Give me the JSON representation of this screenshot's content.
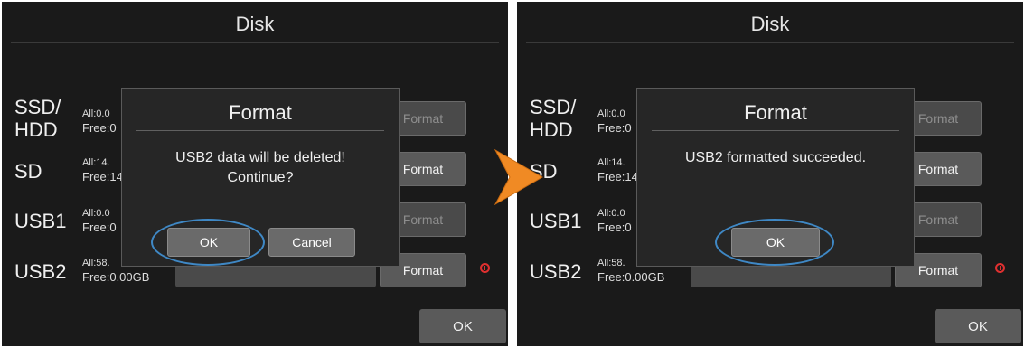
{
  "title": "Disk",
  "disks": [
    {
      "label": "SSD/\nHDD",
      "all": "All:0.0",
      "free": "Free:0",
      "format": "Format",
      "enabled": false
    },
    {
      "label": "SD",
      "all": "All:14.",
      "free": "Free:14",
      "format": "Format",
      "enabled": true
    },
    {
      "label": "USB1",
      "all": "All:0.0",
      "free": "Free:0",
      "format": "Format",
      "enabled": false
    },
    {
      "label": "USB2",
      "all": "All:58.",
      "free": "Free:0.00GB",
      "format": "Format",
      "enabled": true
    }
  ],
  "ok_label": "OK",
  "left_dialog": {
    "title": "Format",
    "message_line1": "USB2 data will be deleted!",
    "message_line2": "Continue?",
    "ok_label": "OK",
    "cancel_label": "Cancel"
  },
  "right_dialog": {
    "title": "Format",
    "message": "USB2 formatted succeeded.",
    "ok_label": "OK"
  },
  "right_disks": [
    {
      "label": "SSD/\nHDD",
      "all": "All:0.0",
      "free": "Free:0",
      "format": "Format"
    },
    {
      "label": "SD",
      "all": "All:14.",
      "free": "Free:14",
      "format": "Format"
    },
    {
      "label": "USB1",
      "all": "All:0.0",
      "free": "Free:0",
      "format": "Format"
    },
    {
      "label": "USB2",
      "all": "All:58.",
      "free": "Free:0.00GB",
      "format": "Format"
    }
  ],
  "colors": {
    "accent_ring": "#3f88c5",
    "arrow": "#f08a24",
    "warning": "#e03030"
  },
  "icons": {
    "warning": "warning-icon",
    "arrow": "arrow-right-icon"
  }
}
